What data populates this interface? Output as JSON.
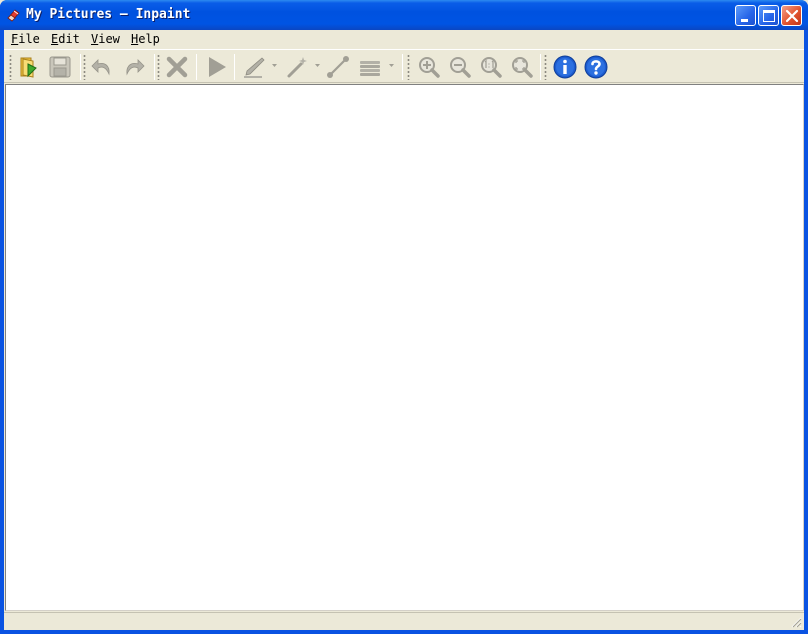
{
  "window": {
    "title": "My Pictures — Inpaint"
  },
  "menu": {
    "items": [
      {
        "label_ul": "F",
        "label_rest": "ile"
      },
      {
        "label_ul": "E",
        "label_rest": "dit"
      },
      {
        "label_ul": "V",
        "label_rest": "iew"
      },
      {
        "label_ul": "H",
        "label_rest": "elp"
      }
    ]
  },
  "toolbar": {
    "buttons": [
      {
        "icon": "open-folder-icon",
        "enabled": true
      },
      {
        "icon": "save-icon",
        "enabled": false
      },
      {
        "icon": "undo-icon",
        "enabled": false
      },
      {
        "icon": "redo-icon",
        "enabled": false
      },
      {
        "icon": "erase-icon",
        "enabled": false
      },
      {
        "icon": "run-icon",
        "enabled": false
      },
      {
        "icon": "marker-icon",
        "enabled": false
      },
      {
        "icon": "magic-wand-icon",
        "enabled": false
      },
      {
        "icon": "guide-line-icon",
        "enabled": false
      },
      {
        "icon": "stack-icon",
        "enabled": false
      },
      {
        "icon": "zoom-in-icon",
        "enabled": false
      },
      {
        "icon": "zoom-out-icon",
        "enabled": false
      },
      {
        "icon": "zoom-actual-icon",
        "enabled": false
      },
      {
        "icon": "zoom-fit-icon",
        "enabled": false
      },
      {
        "icon": "info-icon",
        "enabled": true
      },
      {
        "icon": "help-icon",
        "enabled": true
      }
    ]
  },
  "status": {
    "text": ""
  },
  "colors": {
    "titlebar": "#0054E3",
    "face": "#ECE9D8",
    "disabled_icon": "#A19F95",
    "info_blue": "#1C5CD0"
  }
}
